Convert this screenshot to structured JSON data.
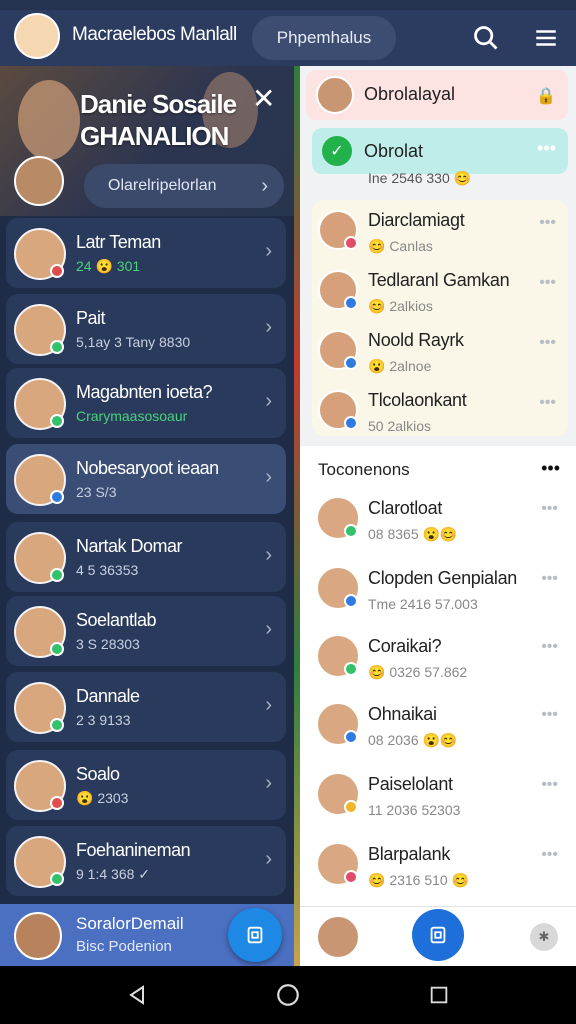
{
  "topbar": {
    "title": "Macraelebos Manlall",
    "pill": "Phpemhalus"
  },
  "left": {
    "hero_title": "Danie Sosaile GHANALION",
    "hero_search": "Olarelripelorlan",
    "rows": [
      {
        "name": "Latr Teman",
        "sub": "24 😮 301",
        "active": false,
        "status": "red"
      },
      {
        "name": "Pait",
        "sub": "5,1ay 3 Tany 8830",
        "active": false,
        "status": "green"
      },
      {
        "name": "Magabnten ioeta?",
        "sub": "Crarymaasosoaur",
        "active": false,
        "status": "green"
      },
      {
        "name": "Nobesaryoot ieaan",
        "sub": "23 S/3",
        "active": true,
        "status": "blue"
      },
      {
        "name": "Nartak Domar",
        "sub": "4 5 36353",
        "active": false,
        "status": "green"
      },
      {
        "name": "Soelantlab",
        "sub": "3 S 28303",
        "active": false,
        "status": "green"
      },
      {
        "name": "Dannale",
        "sub": "2 3 9133",
        "active": false,
        "status": "green"
      },
      {
        "name": "Soalo",
        "sub": "😮 2303",
        "active": false,
        "status": "red"
      },
      {
        "name": "Foehanineman",
        "sub": "9 1:4 368 ✓",
        "active": false,
        "status": "green"
      }
    ],
    "bottom_name": "SoralorDemail",
    "bottom_sub": "Bisc Podenion"
  },
  "right": {
    "header_name": "Obrolalayal",
    "pill_name": "Obrolat",
    "pill_sub": "Ine 2546 330 😊",
    "card_rows": [
      {
        "name": "Diarclamiagt",
        "sub": "😊 Canlas",
        "badge": "pink"
      },
      {
        "name": "Tedlaranl Gamkan",
        "sub": "😊 2alkios",
        "badge": "blue"
      },
      {
        "name": "Noold Rayrk",
        "sub": "😮 2alnoe",
        "badge": "blue"
      },
      {
        "name": "Tlcolaonkant",
        "sub": "50 2alkios",
        "badge": "blue"
      }
    ],
    "section_title": "Toconenons",
    "section_rows": [
      {
        "name": "Clarotloat",
        "sub": "08 8365 😮😊",
        "badge": "green"
      },
      {
        "name": "Clopden Genpialan",
        "sub": "Tme 2416 57.003",
        "badge": "blue"
      },
      {
        "name": "Coraikai?",
        "sub": "😊 0326 57.862",
        "badge": "green"
      },
      {
        "name": "Ohnaikai",
        "sub": "08 2036 😮😊",
        "badge": "blue"
      },
      {
        "name": "Paiselolant",
        "sub": "11 2036 52303",
        "badge": "yellow"
      },
      {
        "name": "Blarpalank",
        "sub": "😊 2316 510 😊",
        "badge": "pink"
      }
    ]
  }
}
